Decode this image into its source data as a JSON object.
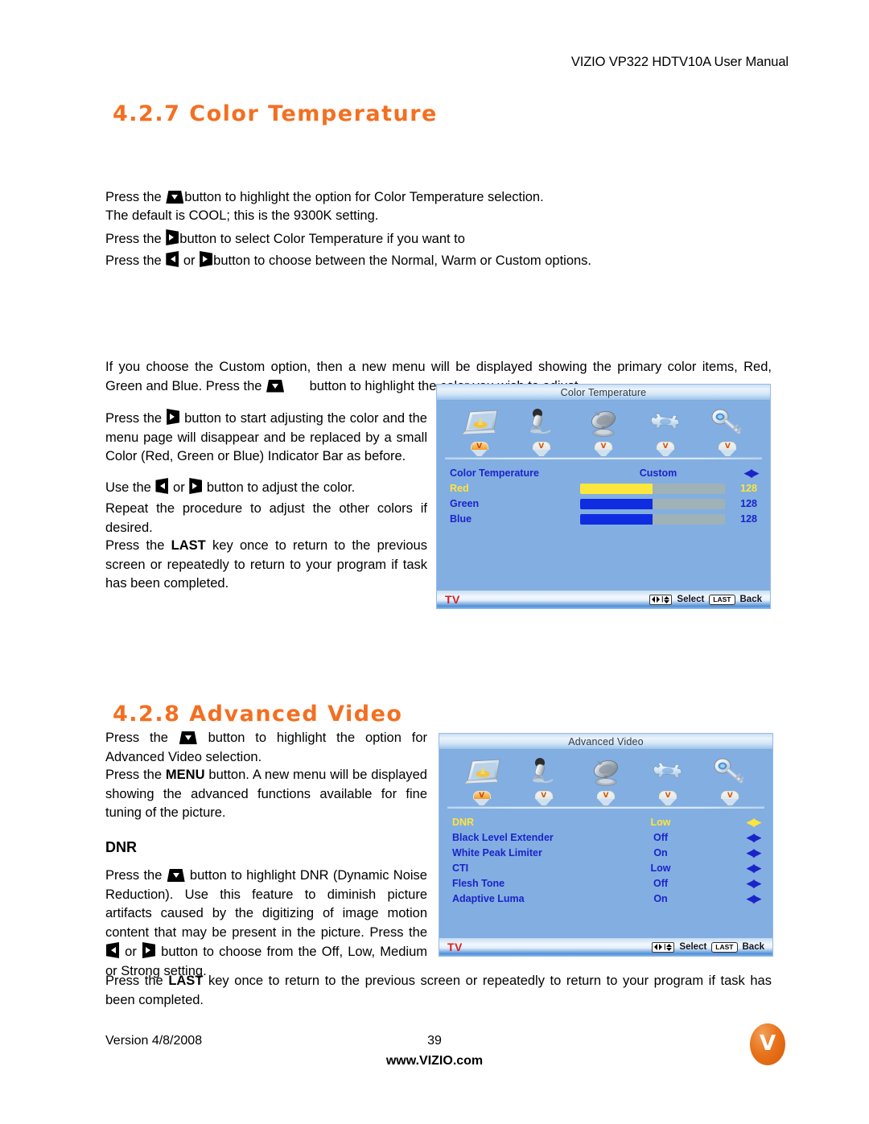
{
  "header": {
    "manual_title": "VIZIO VP322 HDTV10A User Manual"
  },
  "sections": {
    "color_temperature": {
      "number_title": "4.2.7 Color Temperature",
      "intro_lines": [
        "button to highlight the option for Color Temperature selection.",
        "The default is COOL; this is the 9300K setting.",
        "button to select Color Temperature if you want to",
        "button to choose between the Normal, Warm or Custom options."
      ],
      "press_the": "Press the ",
      "or_word": " or ",
      "body": {
        "p1_a": "If you choose the Custom option, then a new menu will be displayed showing the primary color items, Red, Green and Blue.  Press the ",
        "p1_b": " button to highlight the color you wish to adjust.",
        "p2_a": "Press the ",
        "p2_b": " button to start adjusting the color and the menu page will disappear and be replaced by a small Color (Red, Green or Blue) Indicator Bar as before.",
        "p3_a": "Use the ",
        "p3_b": " or ",
        "p3_c": " button to adjust the color.",
        "p4": "Repeat the procedure to adjust the other colors if desired.",
        "p5_a": "Press the ",
        "p5_key": "LAST",
        "p5_b": " key once to return to the previous screen or repeatedly to return to your program if task has been completed."
      }
    },
    "advanced_video": {
      "number_title": "4.2.8 Advanced Video",
      "p1_a": "Press the ",
      "p1_b": " button to highlight the option for Advanced Video selection.",
      "p2_a": "Press the ",
      "p2_key": "MENU",
      "p2_b": " button.  A new menu will be displayed showing the advanced functions available for fine tuning of the picture.",
      "dnr_heading": "DNR",
      "dnr_p_a": "Press the ",
      "dnr_p_b": " button to highlight DNR (Dynamic Noise Reduction).  Use this feature to diminish picture artifacts caused by the digitizing of image motion content that may be present in the picture. Press the ",
      "dnr_p_c": " or ",
      "dnr_p_d": " button to choose from the Off, Low, Medium or Strong setting.",
      "last_a": "Press the ",
      "last_key": "LAST",
      "last_b": " key once to return to the previous screen or repeatedly to return to your program if task has been completed."
    }
  },
  "osd_color_temperature": {
    "title": "Color Temperature",
    "icons": [
      {
        "name": "picture-monitor-icon",
        "selected": true
      },
      {
        "name": "microphone-audio-icon",
        "selected": false
      },
      {
        "name": "satellite-dish-tuner-icon",
        "selected": false
      },
      {
        "name": "wrench-setup-icon",
        "selected": false
      },
      {
        "name": "key-parental-icon",
        "selected": false
      }
    ],
    "vlogo_glyph": "V",
    "rows": [
      {
        "label": "Color Temperature",
        "value": "Custom",
        "type": "option",
        "selected": false
      },
      {
        "label": "Red",
        "value": "128",
        "type": "slider",
        "percent": 50,
        "fill": "red",
        "selected": true
      },
      {
        "label": "Green",
        "value": "128",
        "type": "slider",
        "percent": 50,
        "fill": "green",
        "selected": false
      },
      {
        "label": "Blue",
        "value": "128",
        "type": "slider",
        "percent": 50,
        "fill": "blue",
        "selected": false
      }
    ],
    "status": {
      "source": "TV",
      "navkey": "◀▶ ▲▼",
      "select_label": "Select",
      "last_key": "LAST",
      "back_label": "Back"
    }
  },
  "osd_advanced_video": {
    "title": "Advanced Video",
    "icons": [
      {
        "name": "picture-monitor-icon",
        "selected": true
      },
      {
        "name": "microphone-audio-icon",
        "selected": false
      },
      {
        "name": "satellite-dish-tuner-icon",
        "selected": false
      },
      {
        "name": "wrench-setup-icon",
        "selected": false
      },
      {
        "name": "key-parental-icon",
        "selected": false
      }
    ],
    "vlogo_glyph": "V",
    "rows": [
      {
        "label": "DNR",
        "value": "Low",
        "selected": true
      },
      {
        "label": "Black Level Extender",
        "value": "Off",
        "selected": false
      },
      {
        "label": "White Peak Limiter",
        "value": "On",
        "selected": false
      },
      {
        "label": "CTI",
        "value": "Low",
        "selected": false
      },
      {
        "label": "Flesh Tone",
        "value": "Off",
        "selected": false
      },
      {
        "label": "Adaptive Luma",
        "value": "On",
        "selected": false
      }
    ],
    "status": {
      "source": "TV",
      "navkey": "◀▶ ▲▼",
      "select_label": "Select",
      "last_key": "LAST",
      "back_label": "Back"
    }
  },
  "footer": {
    "version": "Version 4/8/2008",
    "page_number": "39",
    "website": "www.VIZIO.com",
    "logo_glyph": "V"
  },
  "colors": {
    "accent_orange": "#F36F21",
    "osd_background": "#83AEE2",
    "osd_text_blue": "#1A24C8",
    "osd_selected_yellow": "#FFE43A",
    "osd_red_bar": "#FCE73D",
    "osd_blue_bar": "#0F2CE0",
    "tv_red": "#E01B1B"
  }
}
